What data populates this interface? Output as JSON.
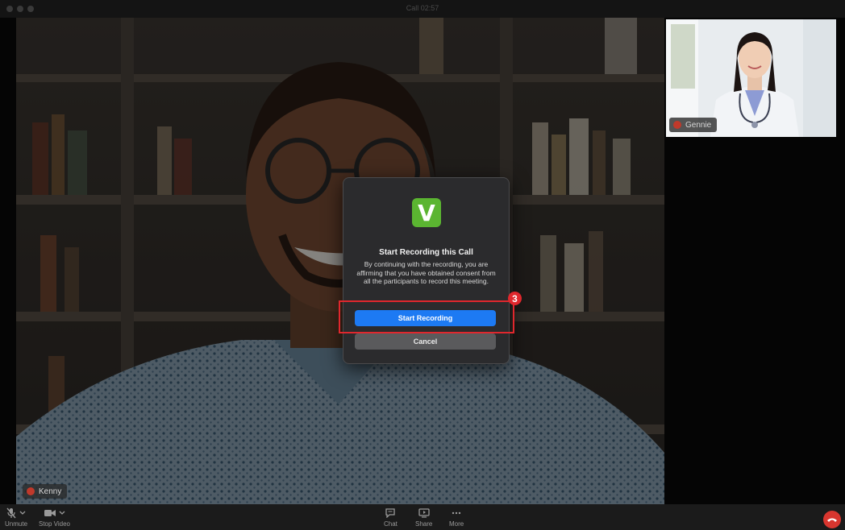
{
  "window": {
    "title": "Call 02:57"
  },
  "participants": {
    "main": {
      "name": "Kenny"
    },
    "thumbnail": {
      "name": "Gennie"
    }
  },
  "dialog": {
    "logo_letter": "V",
    "title": "Start Recording this Call",
    "body": "By continuing with the recording, you are affirming that you have obtained consent from all the participants to record this meeting.",
    "primary_button": "Start Recording",
    "secondary_button": "Cancel",
    "step_badge": "3"
  },
  "toolbar": {
    "unmute_label": "Unmute",
    "stop_video_label": "Stop Video",
    "chat_label": "Chat",
    "share_label": "Share",
    "more_label": "More"
  },
  "icons": {
    "mic": "mic-off-icon",
    "camera": "video-camera-icon",
    "chat": "chat-bubble-icon",
    "share": "share-screen-icon",
    "more": "more-dots-icon",
    "end": "end-call-icon"
  },
  "colors": {
    "accent_blue": "#1d7af3",
    "highlight_red": "#e0272d",
    "logo_green": "#5bb531",
    "end_call_red": "#d9362f"
  }
}
